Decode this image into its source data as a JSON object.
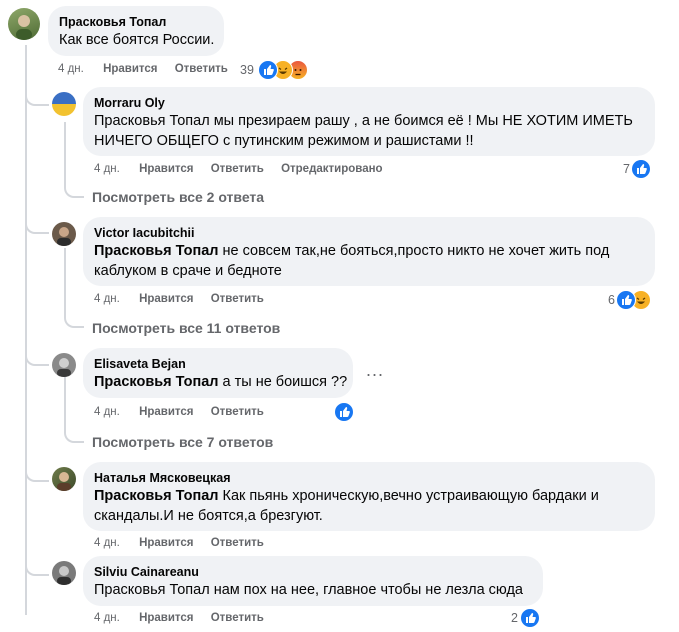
{
  "top_comment": {
    "author": "Прасковья Топал",
    "text": "Как все боятся России.",
    "time": "4 дн.",
    "like_label": "Нравится",
    "reply_label": "Ответить",
    "reaction_count": "39",
    "reactions": [
      "like-icon",
      "haha-icon",
      "angry-icon"
    ]
  },
  "replies": [
    {
      "author": "Morraru Oly",
      "line1": "Прасковья Топал мы презираем рашу , а не боимся её ! Мы НЕ ХОТИМ ИМЕТЬ",
      "line2": "НИЧЕГО ОБЩЕГО с путинским режимом и рашистами !!",
      "time": "4 дн.",
      "like_label": "Нравится",
      "reply_label": "Ответить",
      "edited_label": "Отредактировано",
      "reaction_count": "7",
      "view_all": "Посмотреть все 2 ответа"
    },
    {
      "author": "Victor Iacubitchii",
      "mention": "Прасковья Топал",
      "line1_rest": " не совсем так,не бояться,просто никто не хочет жить под",
      "line2": "каблуком в сраче и бедноте",
      "time": "4 дн.",
      "like_label": "Нравится",
      "reply_label": "Ответить",
      "reaction_count": "6",
      "view_all": "Посмотреть все 11 ответов"
    },
    {
      "author": "Elisaveta Bejan",
      "mention": "Прасковья Топал",
      "line1_rest": " а ты не боишся ??",
      "time": "4 дн.",
      "like_label": "Нравится",
      "reply_label": "Ответить",
      "more": "...",
      "view_all": "Посмотреть все 7 ответов"
    },
    {
      "author": "Наталья Мясковецкая",
      "mention": "Прасковья Топал",
      "line1_rest": " Как пьянь хроническую,вечно устраивающую бардаки и",
      "line2": "скандалы.И не боятся,а брезгуют.",
      "time": "4 дн.",
      "like_label": "Нравится",
      "reply_label": "Ответить"
    },
    {
      "author": "Silviu Cainareanu",
      "line1": "Прасковья Топал нам пох на нее, главное чтобы не лезла сюда",
      "time": "4 дн.",
      "like_label": "Нравится",
      "reply_label": "Ответить",
      "reaction_count": "2"
    }
  ],
  "colors": {
    "bubble": "#f0f2f5",
    "meta": "#65676b",
    "like": "#1877f2",
    "haha": "#f7b125",
    "angry": "#e9573f"
  }
}
